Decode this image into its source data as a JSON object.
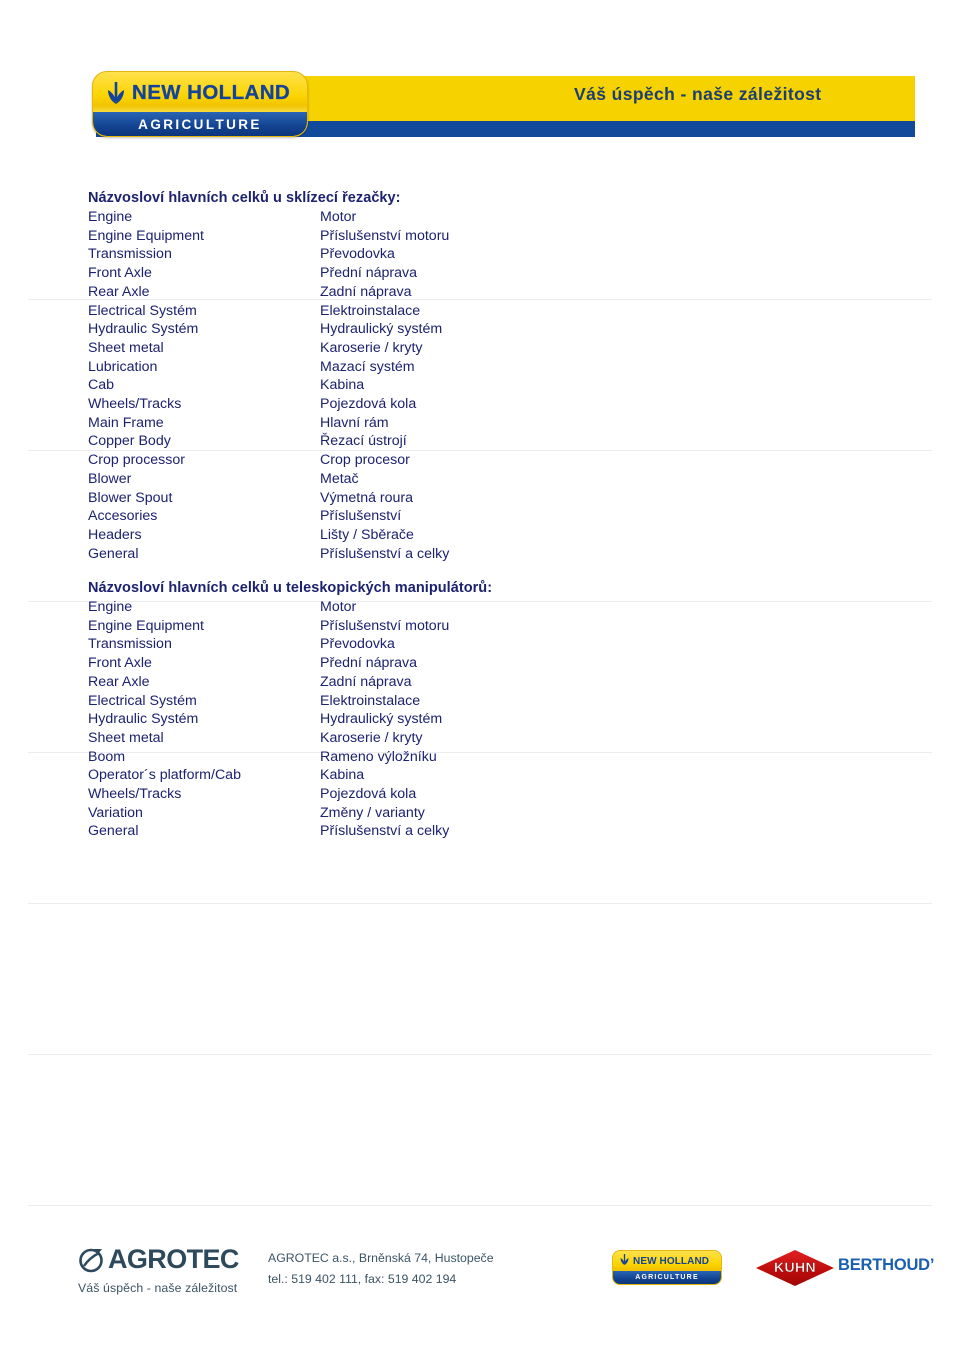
{
  "header": {
    "logo": {
      "brand": "NEW HOLLAND",
      "sub": "AGRICULTURE",
      "icon": "leaf-icon"
    },
    "slogan": "Váš úspěch - naše záležitost",
    "colors": {
      "yellow": "#f6d200",
      "blue": "#114a9a",
      "text": "#1c3e72"
    }
  },
  "sections": [
    {
      "title": "Názvosloví hlavních celků u sklízecí řezačky:",
      "rows": [
        {
          "en": "Engine",
          "cz": "Motor"
        },
        {
          "en": "Engine Equipment",
          "cz": "Příslušenství motoru"
        },
        {
          "en": "Transmission",
          "cz": "Převodovka"
        },
        {
          "en": "Front Axle",
          "cz": "Přední náprava"
        },
        {
          "en": "Rear Axle",
          "cz": "Zadní náprava"
        },
        {
          "en": "Electrical Systém",
          "cz": "Elektroinstalace"
        },
        {
          "en": "Hydraulic Systém",
          "cz": "Hydraulický systém"
        },
        {
          "en": "Sheet metal",
          "cz": "Karoserie / kryty"
        },
        {
          "en": "Lubrication",
          "cz": "Mazací systém"
        },
        {
          "en": "Cab",
          "cz": "Kabina"
        },
        {
          "en": "Wheels/Tracks",
          "cz": "Pojezdová kola"
        },
        {
          "en": "Main Frame",
          "cz": "Hlavní rám"
        },
        {
          "en": "Copper Body",
          "cz": "Řezací ústrojí"
        },
        {
          "en": "Crop processor",
          "cz": "Crop procesor"
        },
        {
          "en": "Blower",
          "cz": "Metač"
        },
        {
          "en": "Blower Spout",
          "cz": "Výmetná roura"
        },
        {
          "en": "Accesories",
          "cz": "Příslušenství"
        },
        {
          "en": "Headers",
          "cz": "Lišty / Sběrače"
        },
        {
          "en": "General",
          "cz": "Příslušenství a celky"
        }
      ]
    },
    {
      "title": "Názvosloví hlavních celků u teleskopických manipulátorů:",
      "rows": [
        {
          "en": "Engine",
          "cz": "Motor"
        },
        {
          "en": "Engine Equipment",
          "cz": "Příslušenství motoru"
        },
        {
          "en": "Transmission",
          "cz": "Převodovka"
        },
        {
          "en": "Front Axle",
          "cz": "Přední náprava"
        },
        {
          "en": "Rear Axle",
          "cz": "Zadní náprava"
        },
        {
          "en": "Electrical Systém",
          "cz": "Elektroinstalace"
        },
        {
          "en": "Hydraulic Systém",
          "cz": "Hydraulický systém"
        },
        {
          "en": "Sheet metal",
          "cz": "Karoserie / kryty"
        },
        {
          "en": "Boom",
          "cz": "Rameno výložníku"
        },
        {
          "en": "Operator´s platform/Cab",
          "cz": "Kabina"
        },
        {
          "en": "Wheels/Tracks",
          "cz": "Pojezdová kola"
        },
        {
          "en": "Variation",
          "cz": "Změny / varianty"
        },
        {
          "en": "General",
          "cz": "Příslušenství a celky"
        }
      ]
    }
  ],
  "footer": {
    "agrotec": {
      "name": "AGROTEC",
      "tagline": "Váš úspěch - naše záležitost",
      "icon": "agrotec-swirl-icon"
    },
    "contact": {
      "line1": "AGROTEC a.s., Brněnská 74, Hustopeče",
      "line2": "tel.: 519 402 111, fax: 519 402 194"
    },
    "brands": [
      {
        "name": "NEW HOLLAND",
        "sub": "AGRICULTURE"
      },
      {
        "name": "KUHN"
      },
      {
        "name": "BERTHOUD’"
      }
    ]
  }
}
